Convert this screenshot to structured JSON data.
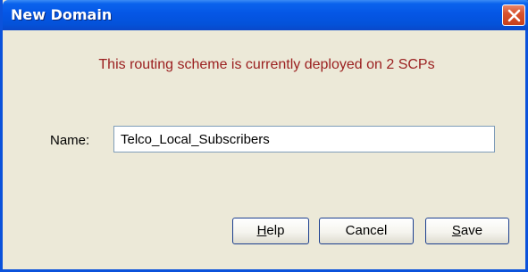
{
  "window": {
    "title": "New Domain",
    "close_icon": "close-icon"
  },
  "message": "This routing scheme is currently deployed on 2 SCPs",
  "form": {
    "name_label": "Name:",
    "name_value": "Telco_Local_Subscribers"
  },
  "buttons": {
    "help": {
      "mnemonic": "H",
      "rest": "elp"
    },
    "cancel": {
      "label": "Cancel"
    },
    "save": {
      "mnemonic": "S",
      "rest": "ave"
    }
  },
  "colors": {
    "titlebar": "#0556e5",
    "message_text": "#9b2020",
    "dialog_background": "#ece9d8",
    "close_button": "#d9532e"
  }
}
